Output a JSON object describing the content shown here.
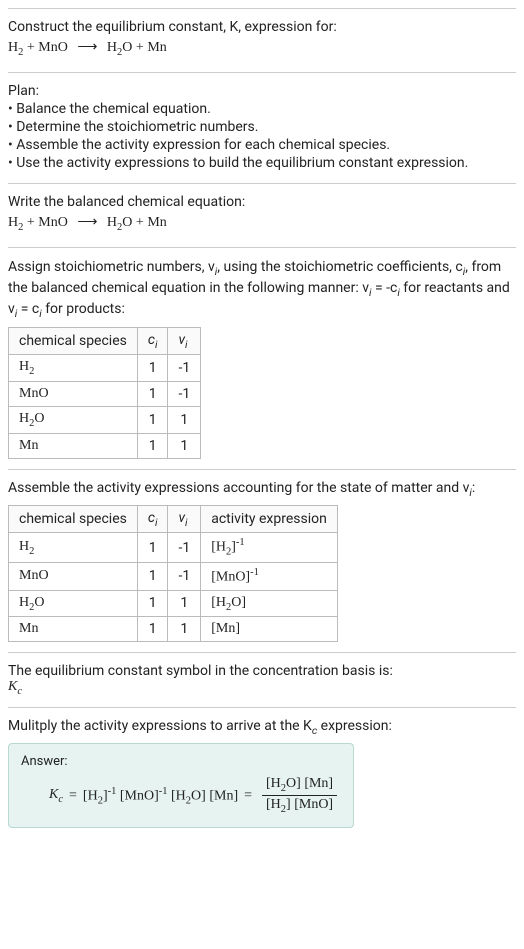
{
  "header": {
    "prompt": "Construct the equilibrium constant, K, expression for:",
    "reactant1": "H",
    "reactant1_sub": "2",
    "plus1": " + ",
    "reactant2": "MnO",
    "arrow": "⟶",
    "product1": "H",
    "product1_sub": "2",
    "product1_suffix": "O",
    "plus2": " + ",
    "product2": "Mn"
  },
  "plan": {
    "label": "Plan:",
    "items": [
      "Balance the chemical equation.",
      "Determine the stoichiometric numbers.",
      "Assemble the activity expression for each chemical species.",
      "Use the activity expressions to build the equilibrium constant expression."
    ]
  },
  "balanced": {
    "label": "Write the balanced chemical equation:",
    "reactant1": "H",
    "reactant1_sub": "2",
    "plus1": " + ",
    "reactant2": "MnO",
    "arrow": "⟶",
    "product1": "H",
    "product1_sub": "2",
    "product1_suffix": "O",
    "plus2": " + ",
    "product2": "Mn"
  },
  "stoich": {
    "para_a": "Assign stoichiometric numbers, ν",
    "para_a_sub": "i",
    "para_b": ", using the stoichiometric coefficients, c",
    "para_b_sub": "i",
    "para_c": ", from the balanced chemical equation in the following manner: ν",
    "para_c_sub": "i",
    "para_d": " = -c",
    "para_d_sub": "i",
    "para_e": " for reactants and ν",
    "para_e_sub": "i",
    "para_f": " = c",
    "para_f_sub": "i",
    "para_g": " for products:",
    "headers": {
      "species": "chemical species",
      "ci": "c",
      "ci_sub": "i",
      "vi": "ν",
      "vi_sub": "i"
    },
    "rows": [
      {
        "species_a": "H",
        "species_sub": "2",
        "species_b": "",
        "ci": "1",
        "vi": "-1"
      },
      {
        "species_a": "MnO",
        "species_sub": "",
        "species_b": "",
        "ci": "1",
        "vi": "-1"
      },
      {
        "species_a": "H",
        "species_sub": "2",
        "species_b": "O",
        "ci": "1",
        "vi": "1"
      },
      {
        "species_a": "Mn",
        "species_sub": "",
        "species_b": "",
        "ci": "1",
        "vi": "1"
      }
    ]
  },
  "activity": {
    "label_a": "Assemble the activity expressions accounting for the state of matter and ν",
    "label_sub": "i",
    "label_b": ":",
    "headers": {
      "species": "chemical species",
      "ci": "c",
      "ci_sub": "i",
      "vi": "ν",
      "vi_sub": "i",
      "expr": "activity expression"
    },
    "rows": [
      {
        "species_a": "H",
        "species_sub": "2",
        "species_b": "",
        "ci": "1",
        "vi": "-1",
        "expr_a": "[H",
        "expr_sub": "2",
        "expr_b": "]",
        "expr_sup": "-1"
      },
      {
        "species_a": "MnO",
        "species_sub": "",
        "species_b": "",
        "ci": "1",
        "vi": "-1",
        "expr_a": "[MnO]",
        "expr_sub": "",
        "expr_b": "",
        "expr_sup": "-1"
      },
      {
        "species_a": "H",
        "species_sub": "2",
        "species_b": "O",
        "ci": "1",
        "vi": "1",
        "expr_a": "[H",
        "expr_sub": "2",
        "expr_b": "O]",
        "expr_sup": ""
      },
      {
        "species_a": "Mn",
        "species_sub": "",
        "species_b": "",
        "ci": "1",
        "vi": "1",
        "expr_a": "[Mn]",
        "expr_sub": "",
        "expr_b": "",
        "expr_sup": ""
      }
    ]
  },
  "symbol": {
    "label": "The equilibrium constant symbol in the concentration basis is:",
    "k": "K",
    "k_sub": "c"
  },
  "multiply": {
    "label_a": "Mulitply the activity expressions to arrive at the K",
    "label_sub": "c",
    "label_b": " expression:"
  },
  "answer": {
    "label": "Answer:",
    "k": "K",
    "k_sub": "c",
    "eq": " = ",
    "term1_a": "[H",
    "term1_sub": "2",
    "term1_b": "]",
    "term1_sup": "-1",
    "term2_a": " [MnO]",
    "term2_sup": "-1",
    "term3_a": " [H",
    "term3_sub": "2",
    "term3_b": "O]",
    "term4": " [Mn]",
    "eq2": " = ",
    "num_a": "[H",
    "num_sub": "2",
    "num_b": "O] [Mn]",
    "den_a": "[H",
    "den_sub": "2",
    "den_b": "] [MnO]"
  }
}
